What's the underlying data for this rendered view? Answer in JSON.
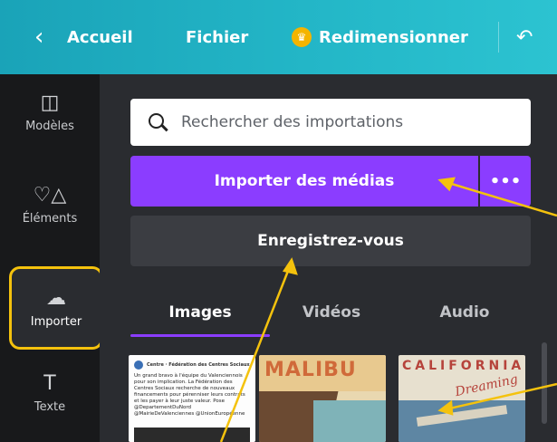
{
  "topbar": {
    "back_glyph": "‹",
    "home_label": "Accueil",
    "file_label": "Fichier",
    "resize_label": "Redimensionner",
    "undo_glyph": "↶",
    "crown_icon": "crown-icon"
  },
  "rail": {
    "items": [
      {
        "label": "Modèles",
        "icon": "templates-icon"
      },
      {
        "label": "Éléments",
        "icon": "elements-icon"
      },
      {
        "label": "Importer",
        "icon": "cloud-upload-icon"
      },
      {
        "label": "Texte",
        "icon": "text-icon"
      }
    ]
  },
  "panel": {
    "search_placeholder": "Rechercher des importations",
    "import_button": "Importer des médias",
    "more_button": "•••",
    "register_button": "Enregistrez-vous",
    "tabs": [
      {
        "label": "Images",
        "active": true
      },
      {
        "label": "Vidéos",
        "active": false
      },
      {
        "label": "Audio",
        "active": false
      }
    ],
    "thumbs": {
      "tweet_title": "Centre · Fédération des Centres Sociaux",
      "tweet_body": "Un grand bravo à l'équipe du Valenciennois pour son implication. La Fédération des Centres Sociaux recherche de nouveaux financements pour pérenniser leurs contrats et les payer à leur juste valeur. Pose @DepartementDuNord @MairieDeValenciennes @UnionEuropéenne",
      "malibu_title": "MALIBU",
      "california_title": "CALIFORNIA",
      "california_script": "Dreaming"
    }
  },
  "colors": {
    "topbar": "#23b6c7",
    "accent": "#8b3dff",
    "highlight": "#f4c20d",
    "panel": "#2a2c30",
    "rail": "#18191b"
  }
}
